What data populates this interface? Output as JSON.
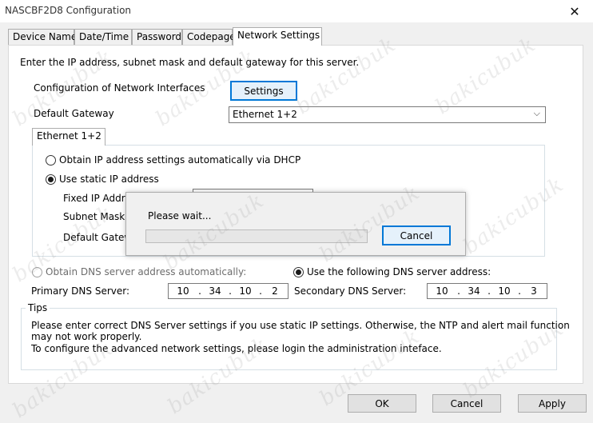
{
  "window": {
    "title": "NASCBF2D8 Configuration"
  },
  "tabs": [
    {
      "label": "Device Name"
    },
    {
      "label": "Date/Time"
    },
    {
      "label": "Password"
    },
    {
      "label": "Codepage"
    },
    {
      "label": "Network Settings"
    }
  ],
  "network": {
    "intro": "Enter the IP address, subnet mask and default gateway for this server.",
    "config_label": "Configuration of Network Interfaces",
    "settings_button": "Settings",
    "gateway_label": "Default Gateway",
    "gateway_value": "Ethernet 1+2",
    "interface_tab": "Ethernet 1+2",
    "dhcp_radio": "Obtain IP address settings automatically via DHCP",
    "static_radio": "Use static IP address",
    "fixed_ip_label": "Fixed IP Addre",
    "subnet_label": "Subnet Mask:",
    "default_gateway_label": "Default Gatew",
    "dns_auto_radio": "Obtain DNS server address automatically:",
    "dns_manual_radio": "Use the following DNS server address:",
    "primary_dns_label": "Primary DNS Server:",
    "primary_dns": [
      "10",
      "34",
      "10",
      "2"
    ],
    "secondary_dns_label": "Secondary DNS Server:",
    "secondary_dns": [
      "10",
      "34",
      "10",
      "3"
    ]
  },
  "tips": {
    "title": "Tips",
    "line1": "Please enter correct DNS Server settings if you use static IP settings.  Otherwise, the NTP and alert mail function",
    "line2": "may not work properly.",
    "line3": "To configure the advanced network settings, please login the administration inteface."
  },
  "modal": {
    "message": "Please wait...",
    "cancel_button": "Cancel",
    "progress_fraction": 0
  },
  "footer": {
    "ok": "OK",
    "cancel": "Cancel",
    "apply": "Apply"
  },
  "watermark": {
    "text": "bakicubuk"
  },
  "colors": {
    "accent": "#0078d7",
    "progress": "#06b025"
  }
}
